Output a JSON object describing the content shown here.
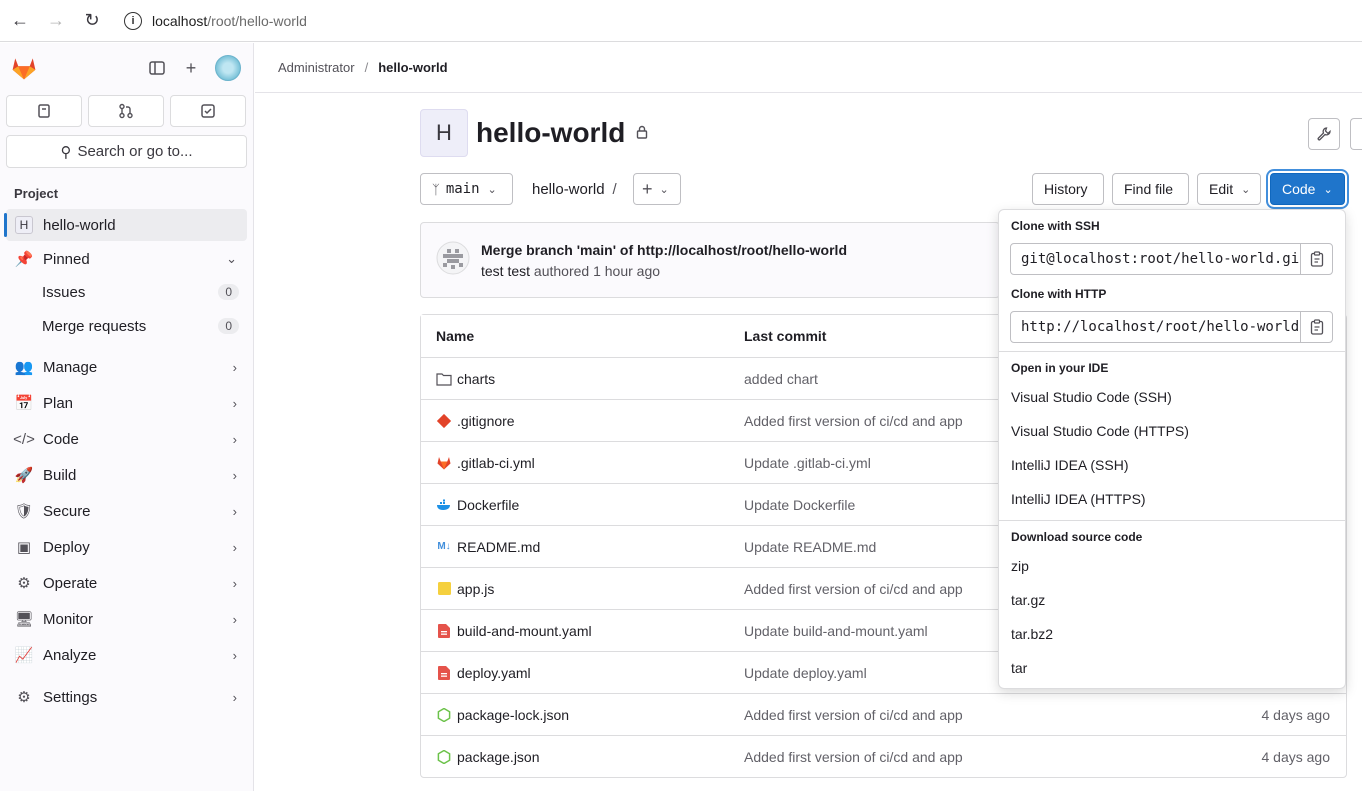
{
  "browser": {
    "url_host": "localhost",
    "url_path": "/root/hello-world"
  },
  "sidebar": {
    "section_title": "Project",
    "search_label": "Search or go to...",
    "project_item": {
      "letter": "H",
      "label": "hello-world"
    },
    "pinned": {
      "label": "Pinned",
      "items": [
        {
          "label": "Issues",
          "count": "0"
        },
        {
          "label": "Merge requests",
          "count": "0"
        }
      ]
    },
    "items": [
      {
        "label": "Manage",
        "icon": "users-icon"
      },
      {
        "label": "Plan",
        "icon": "calendar-icon"
      },
      {
        "label": "Code",
        "icon": "code-icon"
      },
      {
        "label": "Build",
        "icon": "rocket-icon"
      },
      {
        "label": "Secure",
        "icon": "shield-icon"
      },
      {
        "label": "Deploy",
        "icon": "deploy-icon"
      },
      {
        "label": "Operate",
        "icon": "cloud-gear-icon"
      },
      {
        "label": "Monitor",
        "icon": "monitor-icon"
      },
      {
        "label": "Analyze",
        "icon": "chart-icon"
      },
      {
        "label": "Settings",
        "icon": "gear-icon"
      }
    ]
  },
  "breadcrumb": {
    "parent": "Administrator",
    "current": "hello-world"
  },
  "project": {
    "avatar_letter": "H",
    "title": "hello-world"
  },
  "toolbar": {
    "branch": "main",
    "path": "hello-world",
    "history": "History",
    "find_file": "Find file",
    "edit": "Edit",
    "code": "Code"
  },
  "commit": {
    "title": "Merge branch 'main' of http://localhost/root/hello-world",
    "author": "test test",
    "action": "authored",
    "time": "1 hour ago"
  },
  "table": {
    "headers": {
      "name": "Name",
      "last_commit": "Last commit"
    },
    "rows": [
      {
        "name": "charts",
        "commit": "added chart",
        "date": "",
        "icon": "folder-icon"
      },
      {
        "name": ".gitignore",
        "commit": "Added first version of ci/cd and app",
        "date": "",
        "icon": "git-icon"
      },
      {
        "name": ".gitlab-ci.yml",
        "commit": "Update .gitlab-ci.yml",
        "date": "",
        "icon": "gitlab-icon"
      },
      {
        "name": "Dockerfile",
        "commit": "Update Dockerfile",
        "date": "",
        "icon": "docker-icon"
      },
      {
        "name": "README.md",
        "commit": "Update README.md",
        "date": "",
        "icon": "markdown-icon"
      },
      {
        "name": "app.js",
        "commit": "Added first version of ci/cd and app",
        "date": "",
        "icon": "js-icon"
      },
      {
        "name": "build-and-mount.yaml",
        "commit": "Update build-and-mount.yaml",
        "date": "",
        "icon": "yaml-icon"
      },
      {
        "name": "deploy.yaml",
        "commit": "Update deploy.yaml",
        "date": "",
        "icon": "yaml-icon"
      },
      {
        "name": "package-lock.json",
        "commit": "Added first version of ci/cd and app",
        "date": "4 days ago",
        "icon": "node-icon"
      },
      {
        "name": "package.json",
        "commit": "Added first version of ci/cd and app",
        "date": "4 days ago",
        "icon": "node-icon"
      }
    ]
  },
  "dropdown": {
    "ssh_label": "Clone with SSH",
    "ssh_value": "git@localhost:root/hello-world.git",
    "http_label": "Clone with HTTP",
    "http_value": "http://localhost/root/hello-world.git",
    "ide_label": "Open in your IDE",
    "ide_items": [
      "Visual Studio Code (SSH)",
      "Visual Studio Code (HTTPS)",
      "IntelliJ IDEA (SSH)",
      "IntelliJ IDEA (HTTPS)"
    ],
    "download_label": "Download source code",
    "download_items": [
      "zip",
      "tar.gz",
      "tar.bz2",
      "tar"
    ]
  },
  "colors": {
    "accent": "#1f75cb",
    "gitlab_orange": "#e24329"
  }
}
